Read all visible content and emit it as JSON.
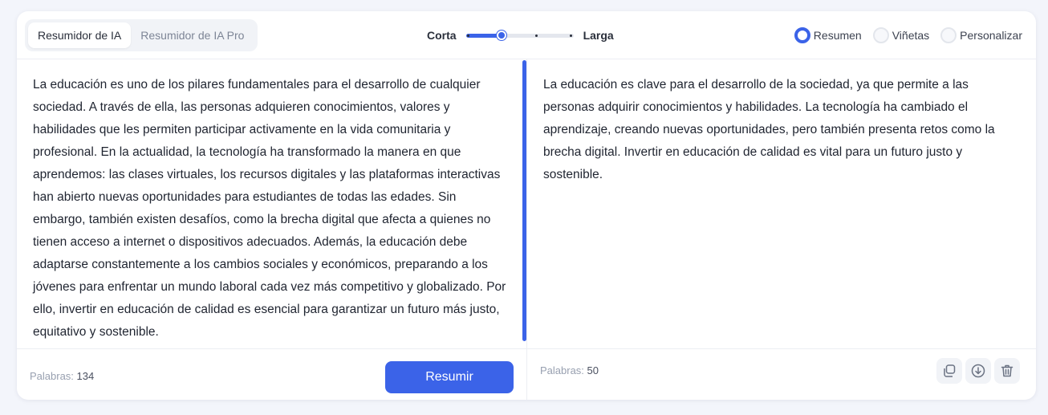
{
  "header": {
    "tabs": [
      {
        "label": "Resumidor de IA",
        "active": true
      },
      {
        "label": "Resumidor de IA Pro",
        "active": false
      }
    ],
    "length": {
      "min_label": "Corta",
      "max_label": "Larga",
      "level": 0.33,
      "steps": 4
    },
    "format_options": [
      {
        "label": "Resumen",
        "selected": true
      },
      {
        "label": "Viñetas",
        "selected": false
      },
      {
        "label": "Personalizar",
        "selected": false
      }
    ]
  },
  "input": {
    "text": "La educación es uno de los pilares fundamentales para el desarrollo de cualquier sociedad. A través de ella, las personas adquieren conocimientos, valores y habilidades que les permiten participar activamente en la vida comunitaria y profesional. En la actualidad, la tecnología ha transformado la manera en que aprendemos: las clases virtuales, los recursos digitales y las plataformas interactivas han abierto nuevas oportunidades para estudiantes de todas las edades. Sin embargo, también existen desafíos, como la brecha digital que afecta a quienes no tienen acceso a internet o dispositivos adecuados. Además, la educación debe adaptarse constantemente a los cambios sociales y económicos, preparando a los jóvenes para enfrentar un mundo laboral cada vez más competitivo y globalizado. Por ello, invertir en educación de calidad es esencial para garantizar un futuro más justo, equitativo y sostenible.",
    "word_label": "Palabras:",
    "word_count": "134",
    "submit_label": "Resumir"
  },
  "output": {
    "text": "La educación es clave para el desarrollo de la sociedad, ya que permite a las personas adquirir conocimientos y habilidades. La tecnología ha cambiado el aprendizaje, creando nuevas oportunidades, pero también presenta retos como la brecha digital. Invertir en educación de calidad es vital para un futuro justo y sostenible.",
    "word_label": "Palabras:",
    "word_count": "50"
  },
  "actions": {
    "copy_icon": "copy-icon",
    "download_icon": "download-icon",
    "delete_icon": "trash-icon"
  },
  "colors": {
    "accent": "#3b63e8",
    "background": "#f3f5fb",
    "muted_text": "#98a0b0"
  }
}
